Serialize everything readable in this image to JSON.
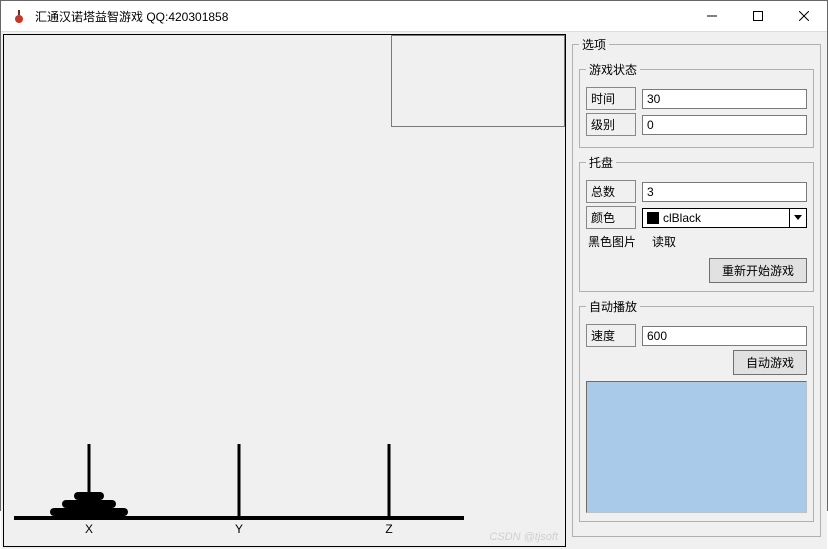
{
  "window": {
    "title": "汇通汉诺塔益智游戏  QQ:420301858"
  },
  "pegs": {
    "x_label": "X",
    "y_label": "Y",
    "z_label": "Z",
    "disc_count_on_x": 3
  },
  "options": {
    "legend": "选项",
    "game_state": {
      "legend": "游戏状态",
      "time_label": "时间",
      "time_value": "30",
      "level_label": "级别",
      "level_value": "0"
    },
    "tray": {
      "legend": "托盘",
      "total_label": "总数",
      "total_value": "3",
      "color_label": "颜色",
      "color_value": "clBlack",
      "color_swatch": "#000000",
      "black_image_label": "黑色图片",
      "read_label": "读取",
      "restart_btn": "重新开始游戏"
    },
    "autoplay": {
      "legend": "自动播放",
      "speed_label": "速度",
      "speed_value": "600",
      "auto_btn": "自动游戏"
    }
  },
  "watermark": "CSDN @tjsoft"
}
